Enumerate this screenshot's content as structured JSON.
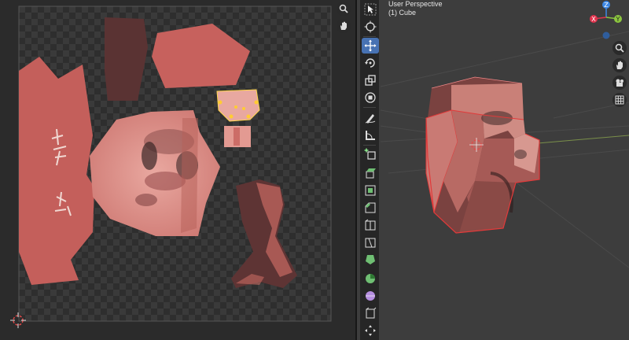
{
  "viewport": {
    "header_line1": "User Perspective",
    "header_line2": "(1) Cube"
  },
  "uv_nav": [
    "zoom-icon",
    "hand-icon"
  ],
  "viewport_nav": [
    "zoom-icon",
    "hand-icon",
    "camera-icon",
    "grid-icon"
  ],
  "gizmo_axes": {
    "z": "Z",
    "x": "X",
    "y": "Y"
  },
  "tools": [
    {
      "name": "select-cursor-icon",
      "active": false
    },
    {
      "name": "3d-cursor-icon",
      "active": false
    },
    {
      "name": "move-icon",
      "active": true
    },
    {
      "name": "rotate-icon",
      "active": false
    },
    {
      "name": "scale-icon",
      "active": false
    },
    {
      "name": "transform-icon",
      "active": false
    },
    {
      "name": "annotate-icon",
      "active": false
    },
    {
      "name": "measure-icon",
      "active": false
    },
    {
      "name": "add-cube-icon",
      "active": false
    },
    {
      "name": "extrude-icon",
      "active": false
    },
    {
      "name": "inset-icon",
      "active": false
    },
    {
      "name": "bevel-icon",
      "active": false
    },
    {
      "name": "loop-cut-icon",
      "active": false
    },
    {
      "name": "knife-icon",
      "active": false
    },
    {
      "name": "poly-build-icon",
      "active": false
    },
    {
      "name": "spin-icon",
      "active": false
    },
    {
      "name": "smooth-icon",
      "active": false
    },
    {
      "name": "shrink-fatten-icon",
      "active": false
    },
    {
      "name": "rip-icon",
      "active": false
    }
  ],
  "colors": {
    "uv_face": "#c8615c",
    "uv_face_dark": "#5a3232",
    "accent": "#4772b3",
    "axis_x": "#e0334d",
    "axis_y": "#8cc63f",
    "axis_z": "#3d88e6"
  }
}
